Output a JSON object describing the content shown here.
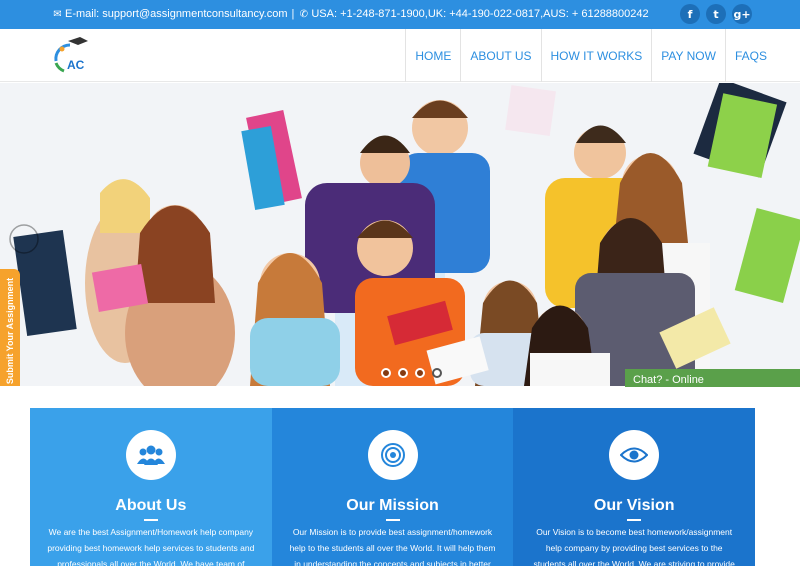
{
  "topbar": {
    "email": "E-mail: support@assignmentconsultancy.com",
    "phones": "USA: +1-248-871-1900,UK: +44-190-022-0817,AUS: + 61288800242",
    "social": [
      {
        "icon": "facebook-icon",
        "glyph": "f"
      },
      {
        "icon": "twitter-icon",
        "glyph": "t"
      },
      {
        "icon": "google-plus-icon",
        "glyph": "g+"
      }
    ]
  },
  "header": {
    "logo_text": "AC",
    "nav": [
      "HOME",
      "ABOUT US",
      "HOW IT WORKS",
      "PAY NOW",
      "FAQS"
    ]
  },
  "hero": {
    "side_tab": "Submit Your Assignment",
    "chat_label": "Chat? - Online",
    "slides": 4,
    "active_slide": 4
  },
  "cards": [
    {
      "title": "About Us",
      "icon": "users-icon",
      "text": "We are the best Assignment/Homework help company providing best homework help services to students and professionals all over the World. We have team of"
    },
    {
      "title": "Our Mission",
      "icon": "target-icon",
      "text": "Our Mission is to provide best assignment/homework help to the students all over the World. It will help them in understanding the concepts and subjects in better and"
    },
    {
      "title": "Our Vision",
      "icon": "eye-icon",
      "text": "Our Vision is to become best homework/assignment help company by providing best services to the students all over the World. We are striving to provide unique experience to"
    }
  ],
  "colors": {
    "topbar": "#2d8fe0",
    "nav_text": "#2d8fe0",
    "card1": "#3aa1ea",
    "card2": "#2486db",
    "card3": "#1b74cc",
    "side_tab": "#f6a22c",
    "chat": "#5aa04a"
  }
}
